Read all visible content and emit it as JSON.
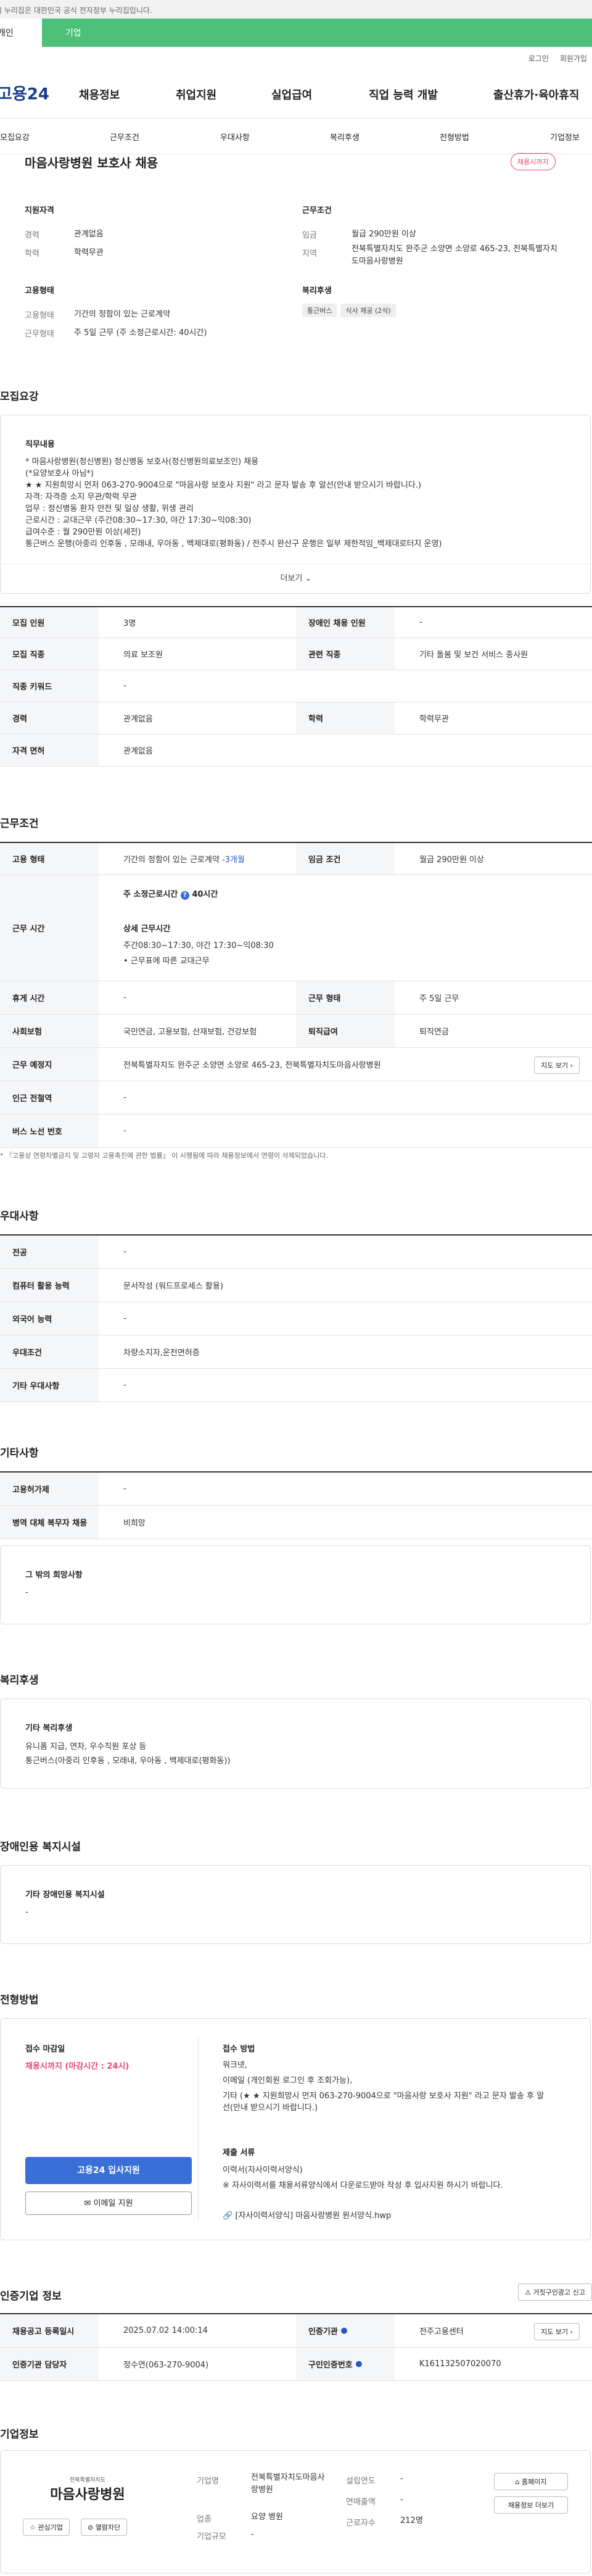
{
  "gov_banner": "이 누리집은 대한민국 공식 전자정부 누리집입니다.",
  "top_tabs": {
    "a": "개인",
    "b": "기업"
  },
  "util": {
    "login": "로그인",
    "join": "회원가입"
  },
  "logo": "고용24",
  "menu": [
    "채용정보",
    "취업지원",
    "실업급여",
    "직업 능력 개발",
    "출산휴가·육아휴직"
  ],
  "subnav": [
    "모집요강",
    "근무조건",
    "우대사항",
    "복리후생",
    "전형방법",
    "기업정보"
  ],
  "job_title": "마음사랑병원 보호사 채용",
  "status_badge": "채용시까지",
  "summary": {
    "qual_title": "지원자격",
    "career_k": "경력",
    "career_v": "관계없음",
    "edu_k": "학력",
    "edu_v": "학력무관",
    "cond_title": "근무조건",
    "wage_k": "임금",
    "wage_v": "월급 290만원 이상",
    "loc_k": "지역",
    "loc_v": "전북특별자치도 완주군 소양면 소양로 465-23, 전북특별자치도마음사랑병원",
    "emp_title": "고용형태",
    "emptype_k": "고용형태",
    "emptype_v": "기간의 정함이 있는 근로계약",
    "worktype_k": "근무형태",
    "worktype_v": "주 5일 근무 (주 소정근로시간: 40시간)",
    "welfare_title": "복리후생",
    "welfare_chips": [
      "통근버스",
      "식사 제공 (2식)"
    ]
  },
  "recruit": {
    "heading": "모집요강",
    "job_desc_title": "직무내용",
    "job_desc": [
      "* 마음사랑병원(정신병원) 정신병동 보호사(정신병원의료보조인) 채용",
      "(*요양보호사 아님*)",
      "★ ★ 지원희망시 먼저 063-270-9004으로 \"마음사랑 보호사 지원\" 라고 문자 발송 후 알선(안내 받으시기 바랍니다.)",
      "자격: 자격증 소지 무관/학력 무관",
      "업무 : 정신병동 환자 안전 및 일상 생활, 위생 관리",
      "근로시간 : 교대근무 (주간08:30~17:30, 야간 17:30~익08:30)",
      "급여수준 : 월 290만원 이상(세전)",
      "통근버스 운행(아중리 인후동 , 모래내, 우아동 , 백제대로(평화동) / 전주시 완산구 운행은 일부 제한적임_백제대로터지 운영)"
    ],
    "more": "더보기",
    "rows": [
      [
        "모집 인원",
        "3명",
        "장애인 채용 인원",
        "-"
      ],
      [
        "모집 직종",
        "의료 보조원",
        "관련 직종",
        "기타 돌봄 및 보건 서비스 종사원"
      ],
      [
        "직종 키워드",
        "-"
      ],
      [
        "경력",
        "관계없음",
        "학력",
        "학력무관"
      ],
      [
        "자격 면허",
        "관계없음"
      ]
    ]
  },
  "conditions": {
    "heading": "근무조건",
    "emp_k": "고용 형태",
    "emp_v": "기간의 정함이 있는 근로계약 - ",
    "emp_v2": "3개월",
    "wage_k": "임금 조건",
    "wage_v": "월급 290만원 이상",
    "time_k": "근무 시간",
    "time_total": "주 소정근로시간",
    "time_total_v": "40시간",
    "time_detail_t": "상세 근무시간",
    "time_detail": "주간08:30~17:30, 야간 17:30~익08:30",
    "time_note": "• 근무표에 따른 교대근무",
    "break_k": "휴게 시간",
    "break_v": "-",
    "worktype_k": "근무 형태",
    "worktype_v": "주 5일 근무",
    "ins_k": "사회보험",
    "ins_v": "국민연금, 고용보험, 산재보험, 건강보험",
    "retire_k": "퇴직급여",
    "retire_v": "퇴직연금",
    "place_k": "근무 예정지",
    "place_v": "전북특별자치도 완주군 소양면 소양로 465-23, 전북특별자치도마음사랑병원",
    "map_btn": "지도 보기",
    "subway_k": "인근 전철역",
    "subway_v": "-",
    "bus_k": "버스 노선 번호",
    "bus_v": "-",
    "note": "* 『고용상 연령차별금지 및 고령자 고용촉진에 관한 법률』 이 시행됨에 따라 채용정보에서 연령이 삭제되었습니다."
  },
  "pref": {
    "heading": "우대사항",
    "rows": [
      [
        "전공",
        "-"
      ],
      [
        "컴퓨터 활용 능력",
        "문서작성 (워드프로세스 활용)"
      ],
      [
        "외국어 능력",
        "-"
      ],
      [
        "우대조건",
        "차량소지자,운전면허증"
      ],
      [
        "기타 우대사항",
        "-"
      ]
    ]
  },
  "etc": {
    "heading": "기타사항",
    "rows": [
      [
        "고용허가제",
        "-"
      ],
      [
        "병역 대체 복무자 채용",
        "비희망"
      ]
    ],
    "other_title": "그 밖의 희망사항",
    "other_v": "-"
  },
  "welfare": {
    "heading": "복리후생",
    "title": "기타 복리후생",
    "lines": [
      "유니폼 지급, 연차, 우수직원 포상 등",
      "통근버스(아중리 인후동 , 모래내, 우아동 , 백제대로(평화동))"
    ]
  },
  "disabled": {
    "heading": "장애인용 복지시설",
    "title": "기타 장애인용 복지시설",
    "v": "-"
  },
  "screening": {
    "heading": "전형방법",
    "deadline_t": "접수 마감일",
    "deadline_v": "채용시까지 (마감시간 : 24시)",
    "apply_btn": "고용24 입사지원",
    "email_btn": "이메일 지원",
    "method_t": "접수 방법",
    "method_lines": [
      "워크넷,",
      "이메일 (개인회원 로그인 후 조회가능),",
      "기타 (★ ★ 지원희망시 먼저 063-270-9004으로 \"마음사랑 보호사 지원\" 라고 문자 발송 후 알",
      "선(안내 받으시기 바랍니다.)"
    ],
    "docs_t": "제출 서류",
    "docs_lines": [
      "이력서(자사이력서양식)",
      "※ 자사이력서를 채용서류양식에서 다운로드받아 작성 후 입사지원 하시기 바랍니다."
    ],
    "file": "[자사이력서양식] 마음사랑병원 원서양식.hwp"
  },
  "cert": {
    "heading": "인증기업 정보",
    "report_btn": "거짓구인광고 신고",
    "reg_k": "채용공고 등록일시",
    "reg_v": "2025.07.02 14:00:14",
    "agency_k": "인증기관",
    "agency_v": "전주고용센터",
    "map_btn": "지도 보기",
    "staff_k": "인증기관 담당자",
    "staff_v": "정수연(063-270-9004)",
    "no_k": "구인인증번호",
    "no_v": "K161132507020070"
  },
  "company": {
    "heading": "기업정보",
    "logo_sub": "전북특별자치도",
    "logo_main": "마음사랑병원",
    "fav_btn": "관심기업",
    "block_btn": "열람차단",
    "name_k": "기업명",
    "name_v": "전북특별자치도마음사랑병원",
    "ind_k": "업종",
    "ind_v": "요양 병원",
    "size_k": "기업규모",
    "size_v": "-",
    "est_k": "설립연도",
    "est_v": "-",
    "sales_k": "연매출액",
    "sales_v": "-",
    "emp_k": "근로자수",
    "emp_v": "212명",
    "home_btn": "홈페이지",
    "more_btn": "채용정보 더보기"
  },
  "colors": {
    "green": "#4ec07a",
    "blue": "#3a6fd8",
    "pink": "#e84a6f",
    "navy": "#1a3e8c"
  }
}
